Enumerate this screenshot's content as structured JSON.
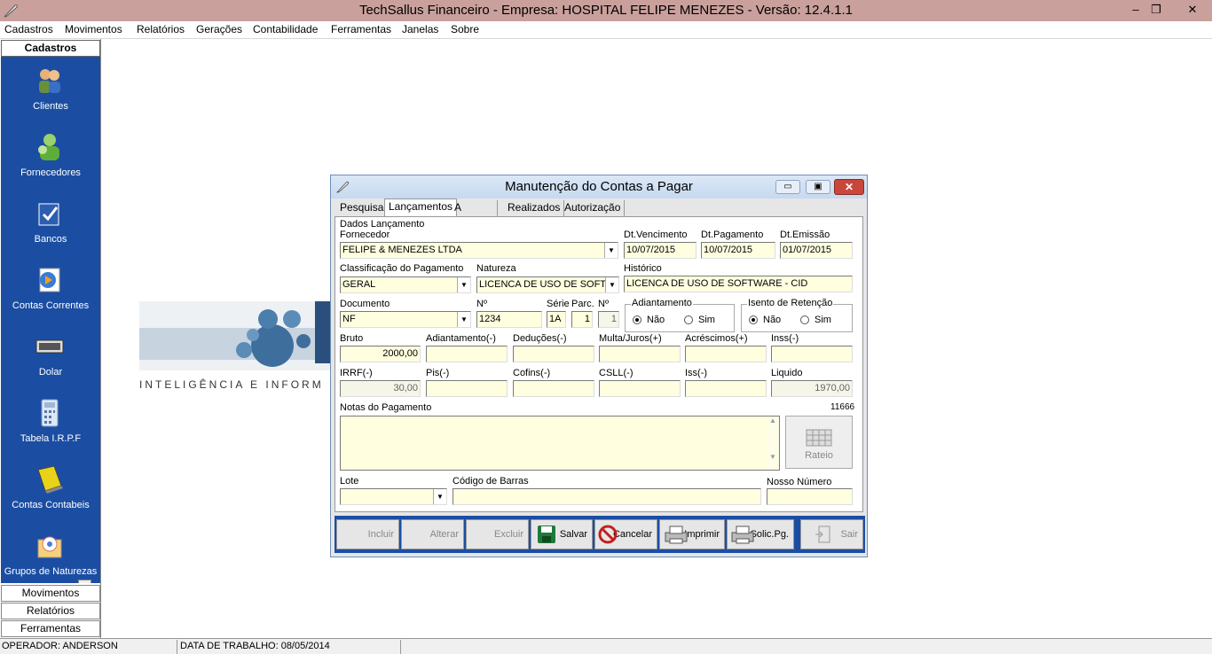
{
  "app": {
    "title": "TechSallus Financeiro - Empresa: HOSPITAL FELIPE MENEZES - Versão: 12.4.1.1",
    "window_buttons": {
      "minimize": "–",
      "restore": "❐",
      "close": "✕"
    }
  },
  "menu": [
    "Cadastros",
    "Movimentos",
    "Relatórios",
    "Gerações",
    "Contabilidade",
    "Ferramentas",
    "Janelas",
    "Sobre"
  ],
  "sidebar": {
    "header": "Cadastros",
    "items": [
      {
        "label": "Clientes",
        "icon": "clients-icon"
      },
      {
        "label": "Fornecedores",
        "icon": "suppliers-icon"
      },
      {
        "label": "Bancos",
        "icon": "banks-icon"
      },
      {
        "label": "Contas Correntes",
        "icon": "current-accounts-icon"
      },
      {
        "label": "Dolar",
        "icon": "dollar-icon"
      },
      {
        "label": "Tabela I.R.P.F",
        "icon": "calculator-icon"
      },
      {
        "label": "Contas Contabeis",
        "icon": "ledger-icon"
      },
      {
        "label": "Grupos de Naturezas",
        "icon": "groups-icon"
      }
    ],
    "scroll_glyph": "▼",
    "groups": [
      "Movimentos",
      "Relatórios",
      "Ferramentas"
    ]
  },
  "logo": {
    "tagline": "INTELIGÊNCIA E INFORM"
  },
  "status": {
    "operator": "OPERADOR: ANDERSON",
    "work_date": "DATA DE TRABALHO: 08/05/2014"
  },
  "colors": {
    "titlebar": "#c9a09c",
    "sidebar": "#1b4ea2",
    "field": "#ffffe0"
  },
  "dialog": {
    "title": "Manutenção do Contas a Pagar",
    "buttons": {
      "minimize": "▭",
      "maximize": "▣",
      "close": "✕"
    },
    "tabs": [
      "Pesquisa",
      "Lançamentos",
      "A Realizar",
      "Realizados",
      "Autorização"
    ],
    "active_tab": "Lançamentos",
    "group_title": "Dados Lançamento",
    "labels": {
      "fornecedor": "Fornecedor",
      "dt_venc": "Dt.Vencimento",
      "dt_pag": "Dt.Pagamento",
      "dt_emis": "Dt.Emissão",
      "classificacao": "Classificação do Pagamento",
      "natureza": "Natureza",
      "historico": "Histórico",
      "documento": "Documento",
      "numero": "Nº",
      "serie": "Série",
      "parc": "Parc.",
      "numero2": "Nº",
      "adiantamento": "Adiantamento",
      "isento": "Isento de Retenção",
      "nao": "Não",
      "sim": "Sim",
      "bruto": "Bruto",
      "adiant": "Adiantamento(-)",
      "deducoes": "Deduções(-)",
      "multa": "Multa/Juros(+)",
      "acrescimos": "Acréscimos(+)",
      "inss": "Inss(-)",
      "irrf": "IRRF(-)",
      "pis": "Pis(-)",
      "cofins": "Cofins(-)",
      "csll": "CSLL(-)",
      "iss": "Iss(-)",
      "liquido": "Liquido",
      "notas": "Notas do Pagamento",
      "lote": "Lote",
      "codigo_barras": "Código de Barras",
      "nosso_numero": "Nosso Número"
    },
    "values": {
      "fornecedor": "FELIPE & MENEZES LTDA",
      "dt_venc": "10/07/2015",
      "dt_pag": "10/07/2015",
      "dt_emis": "01/07/2015",
      "classificacao": "GERAL",
      "natureza": "LICENCA DE USO DE SOFTW",
      "historico": "LICENCA DE USO DE SOFTWARE - CID",
      "documento": "NF",
      "numero": "1234",
      "serie": "1A",
      "parc": "1",
      "numero2": "1",
      "bruto": "2000,00",
      "irrf": "30,00",
      "liquido": "1970,00",
      "id": "11666"
    },
    "dropdown_glyph": "▼",
    "scroll_up": "▲",
    "scroll_down": "▼",
    "rateio": "Rateio",
    "toolbar": [
      "Incluir",
      "Alterar",
      "Excluir",
      "Salvar",
      "Cancelar",
      "Imprimir",
      "Solic.Pg.",
      "Sair"
    ]
  }
}
